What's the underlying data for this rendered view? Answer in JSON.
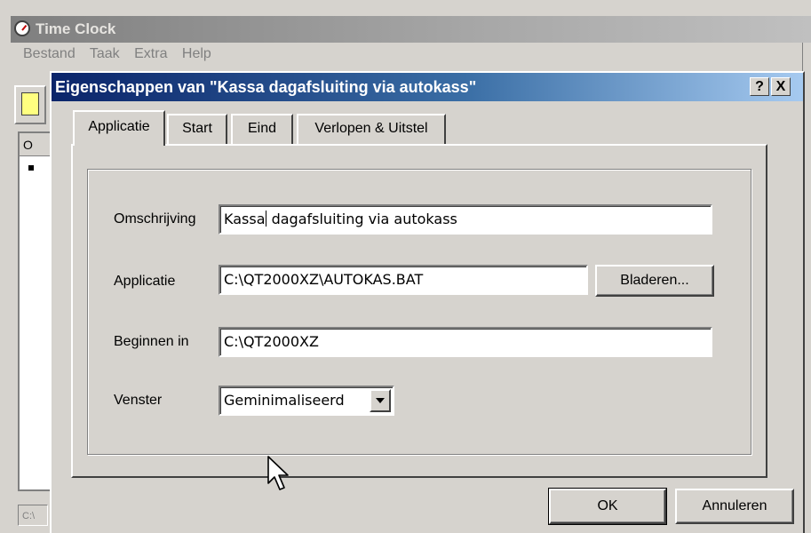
{
  "main_window": {
    "title": "Time Clock",
    "menu": [
      "Bestand",
      "Taak",
      "Extra",
      "Help"
    ],
    "list_column_header": "O",
    "statusbar_text": "C:\\"
  },
  "dialog": {
    "title": "Eigenschappen van \"Kassa dagafsluiting via autokass\"",
    "help_button": "?",
    "close_button": "X",
    "tabs": [
      {
        "label": "Applicatie",
        "selected": true
      },
      {
        "label": "Start",
        "selected": false
      },
      {
        "label": "Eind",
        "selected": false
      },
      {
        "label": "Verlopen & Uitstel",
        "selected": false
      }
    ],
    "fields": {
      "omschrijving": {
        "label": "Omschrijving",
        "value_before_caret": "Kassa",
        "value_after_caret": " dagafsluiting via autokass"
      },
      "applicatie": {
        "label": "Applicatie",
        "value": "C:\\QT2000XZ\\AUTOKAS.BAT",
        "browse_label": "Bladeren..."
      },
      "beginnen_in": {
        "label": "Beginnen in",
        "value": "C:\\QT2000XZ"
      },
      "venster": {
        "label": "Venster",
        "selected": "Geminimaliseerd"
      }
    },
    "ok_label": "OK",
    "cancel_label": "Annuleren"
  }
}
